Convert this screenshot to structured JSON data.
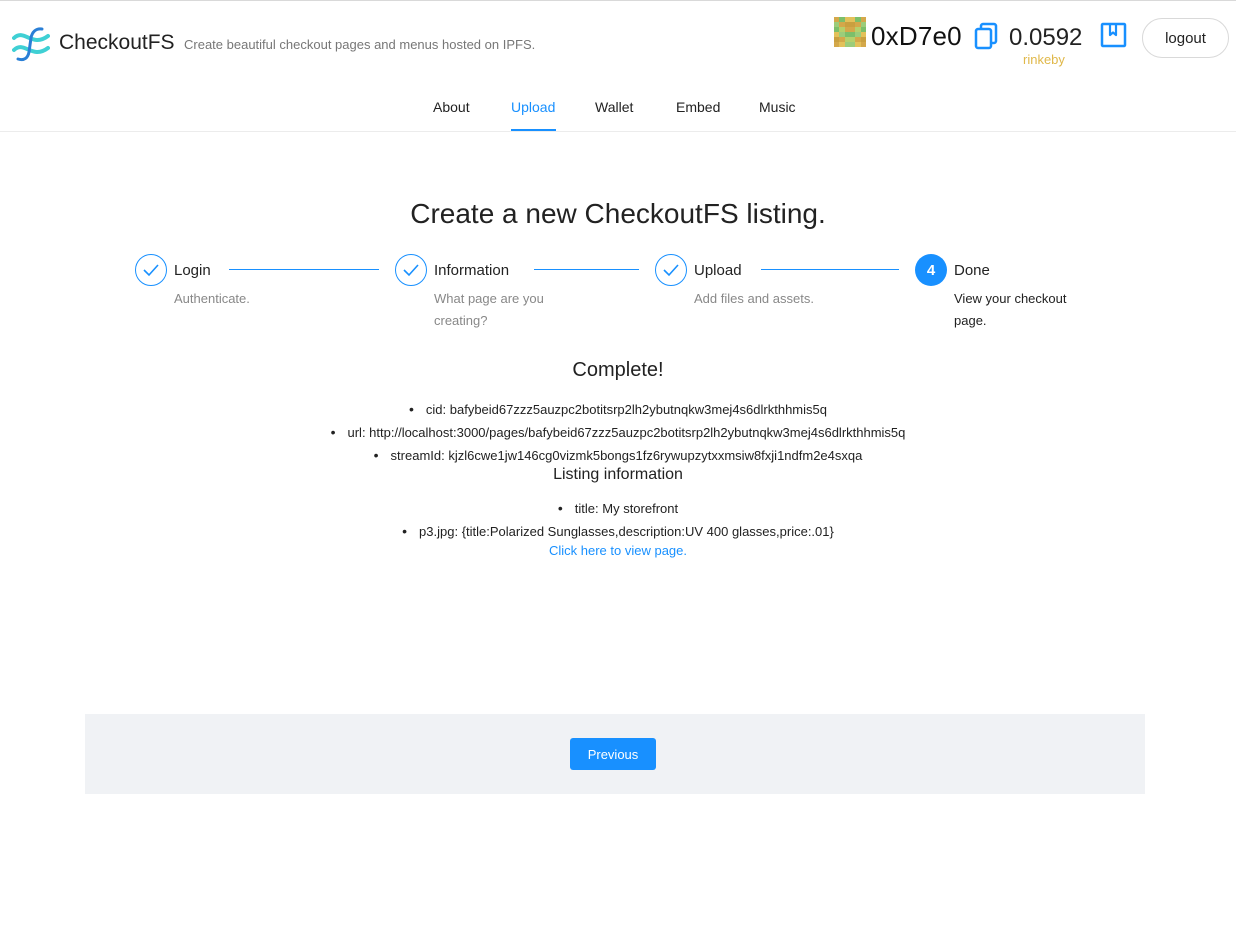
{
  "header": {
    "brand": "CheckoutFS",
    "tagline": "Create beautiful checkout pages and menus hosted on IPFS.",
    "address": "0xD7e0",
    "balance": "0.0592",
    "network": "rinkeby",
    "logout_label": "logout",
    "icons": [
      "checkoutfs-logo-icon",
      "identicon-avatar",
      "copy-icon",
      "book-icon"
    ]
  },
  "nav": {
    "items": [
      {
        "label": "About"
      },
      {
        "label": "Upload"
      },
      {
        "label": "Wallet"
      },
      {
        "label": "Embed"
      },
      {
        "label": "Music"
      }
    ],
    "active": "Upload"
  },
  "main": {
    "title": "Create a new CheckoutFS listing.",
    "steps": [
      {
        "title": "Login",
        "description": "Authenticate.",
        "status": "finished"
      },
      {
        "title": "Information",
        "description": "What page are you creating?",
        "status": "finished"
      },
      {
        "title": "Upload",
        "description": "Add files and assets.",
        "status": "finished"
      },
      {
        "title": "Done",
        "description": "View your checkout page.",
        "status": "current",
        "number": "4"
      }
    ],
    "complete_heading": "Complete!",
    "results": [
      "cid: bafybeid67zzz5auzpc2botitsrp2lh2ybutnqkw3mej4s6dlrkthhmis5q",
      "url: http://localhost:3000/pages/bafybeid67zzz5auzpc2botitsrp2lh2ybutnqkw3mej4s6dlrkthhmis5q",
      "streamId: kjzl6cwe1jw146cg0vizmk5bongs1fz6rywupzytxxmsiw8fxji1ndfm2e4sxqa"
    ],
    "listing_heading": "Listing information",
    "listing_items": [
      "title: My storefront",
      "p3.jpg: {title:Polarized Sunglasses,description:UV 400 glasses,price:.01}"
    ],
    "view_link": "Click here to view page."
  },
  "footer": {
    "previous_label": "Previous"
  },
  "colors": {
    "accent": "#1890ff",
    "network": "#e0b84a",
    "logo_cyan": "#3fd0d4",
    "logo_blue": "#2a7fd6",
    "panel": "#f0f2f5"
  }
}
